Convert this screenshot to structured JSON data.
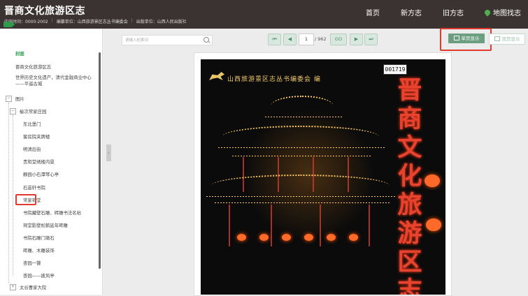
{
  "header": {
    "title": "晋商文化旅游区志",
    "meta": {
      "time": "内容时间：0000-2002",
      "editor": "编纂单位：山西旅游景区志丛书编委会",
      "publisher": "出版单位：山西人民出版社"
    },
    "nav": [
      "首页",
      "新方志",
      "旧方志",
      "地图找志"
    ]
  },
  "sidebar": {
    "cover": "封面",
    "items": [
      "晋商文化旅游区志",
      "世界历史文化遗产，清代金融商业中心——平遥古城",
      "图片",
      "榆次常家庄园",
      "东北堡门",
      "客房院夹牌楼",
      "明清后街",
      "贵和堂绣楼内景",
      "静园小石潭琴心亭",
      "石芸轩书院",
      "常家祠堂",
      "书院藏壁石雕、砖雕书法名帖",
      "祠堂影壁松鹤延年砖雕",
      "书院石雕门墩石",
      "砖雕、木雕装饰",
      "杏园一瞥",
      "杏园——披风亭",
      "太谷曹家大院"
    ]
  },
  "toolbar": {
    "search_placeholder": "请输入检索词",
    "first": "⏮",
    "prev": "◀",
    "page_value": "1",
    "total": "/ 962",
    "go": "GO",
    "next": "▶",
    "last": "⏭",
    "single_view": "单页显示",
    "double_view": "双页显示"
  },
  "document": {
    "publisher_line": "山西旅游景区志丛书编委会 编",
    "code": "001719",
    "title_chars": "晋商文化旅游区志"
  },
  "colors": {
    "header_bg": "#3b3331",
    "accent_green": "#2e9b4e",
    "highlight_red": "#e23a2e",
    "title_red": "#e8432f"
  }
}
